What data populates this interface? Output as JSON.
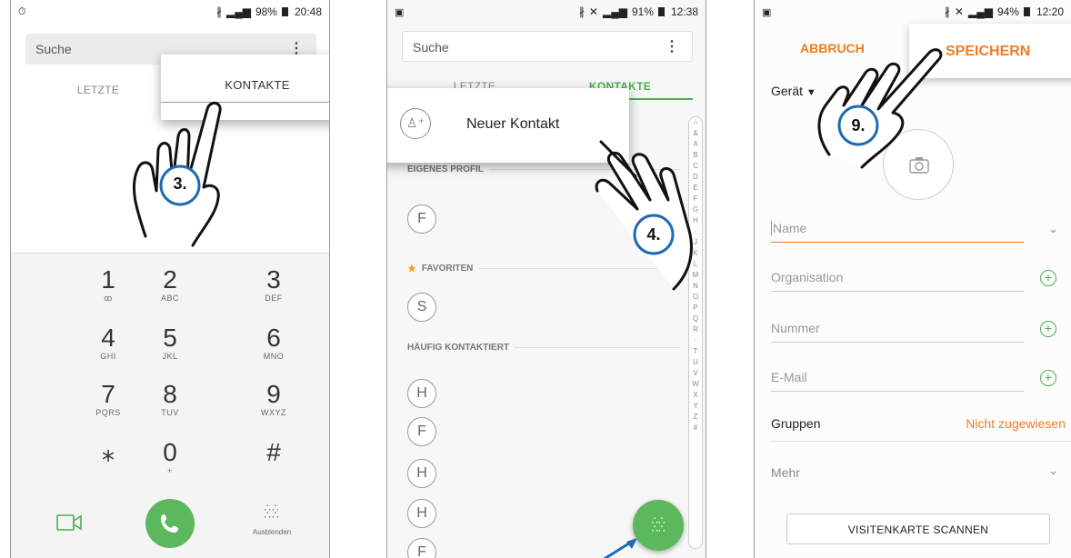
{
  "screen1": {
    "status_right": "98%",
    "status_time": "20:48",
    "search_placeholder": "Suche",
    "tabs": [
      "LETZTE",
      "KONTAKTE"
    ],
    "popup_label": "KONTAKTE",
    "step": "3.",
    "keys": [
      {
        "digit": "1",
        "letters": "ꝏ"
      },
      {
        "digit": "2",
        "letters": "ABC"
      },
      {
        "digit": "3",
        "letters": "DEF"
      },
      {
        "digit": "4",
        "letters": "GHI"
      },
      {
        "digit": "5",
        "letters": "JKL"
      },
      {
        "digit": "6",
        "letters": "MNO"
      },
      {
        "digit": "7",
        "letters": "PQRS"
      },
      {
        "digit": "8",
        "letters": "TUV"
      },
      {
        "digit": "9",
        "letters": "WXYZ"
      },
      {
        "digit": "⁎",
        "letters": ""
      },
      {
        "digit": "0",
        "letters": "+"
      },
      {
        "digit": "#",
        "letters": ""
      }
    ],
    "hide_label": "Ausblenden"
  },
  "screen2": {
    "status_right": "91%",
    "status_time": "12:38",
    "search_placeholder": "Suche",
    "tabs": [
      "LETZTE",
      "KONTAKTE"
    ],
    "popup_label": "Neuer Kontakt",
    "sections": {
      "own_profile": "EIGENES PROFIL",
      "favorites": "FAVORITEN",
      "frequent": "HÄUFIG KONTAKTIERT"
    },
    "avatars": [
      "F",
      "S",
      "H",
      "F",
      "H",
      "H",
      "F"
    ],
    "alphabet": [
      "☆",
      "&",
      "A",
      "B",
      "C",
      "D",
      "E",
      "F",
      "G",
      "H",
      "·",
      "J",
      "K",
      "L",
      "M",
      "N",
      "O",
      "P",
      "Q",
      "R",
      "·",
      "T",
      "U",
      "V",
      "W",
      "X",
      "Y",
      "Z",
      "#"
    ],
    "step": "4."
  },
  "screen3": {
    "status_right": "94%",
    "status_time": "12:20",
    "cancel_label": "ABBRUCH",
    "save_label": "SPEICHERN",
    "storage_label": "Gerät",
    "fields": {
      "name": "Name",
      "organisation": "Organisation",
      "number": "Nummer",
      "email": "E-Mail"
    },
    "groups_label": "Gruppen",
    "groups_value": "Nicht zugewiesen",
    "more_label": "Mehr",
    "scan_label": "VISITENKARTE SCANNEN",
    "step": "9."
  },
  "colors": {
    "accent_green": "#4caf50",
    "accent_orange": "#ef7d22",
    "step_blue": "#1e6bb3"
  }
}
